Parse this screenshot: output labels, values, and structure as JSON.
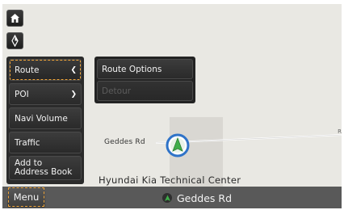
{
  "map": {
    "road_name": "Geddes Rd",
    "poi_name": "Hyundai Kia Technical Center",
    "edge_label": "R"
  },
  "menu": {
    "label": "Menu",
    "items": [
      {
        "label": "Route",
        "active": true
      },
      {
        "label": "POI"
      },
      {
        "label": "Navi Volume"
      },
      {
        "label": "Traffic"
      },
      {
        "label_line1": "Add to",
        "label_line2": "Address Book"
      }
    ]
  },
  "submenu": {
    "items": [
      {
        "label": "Route Options",
        "enabled": true
      },
      {
        "label": "Detour",
        "enabled": false
      }
    ]
  },
  "status": {
    "current_road": "Geddes Rd"
  },
  "colors": {
    "focus_outline": "#f0a53a",
    "vehicle_green": "#3fae4a",
    "vehicle_ring": "#2f73c8"
  }
}
